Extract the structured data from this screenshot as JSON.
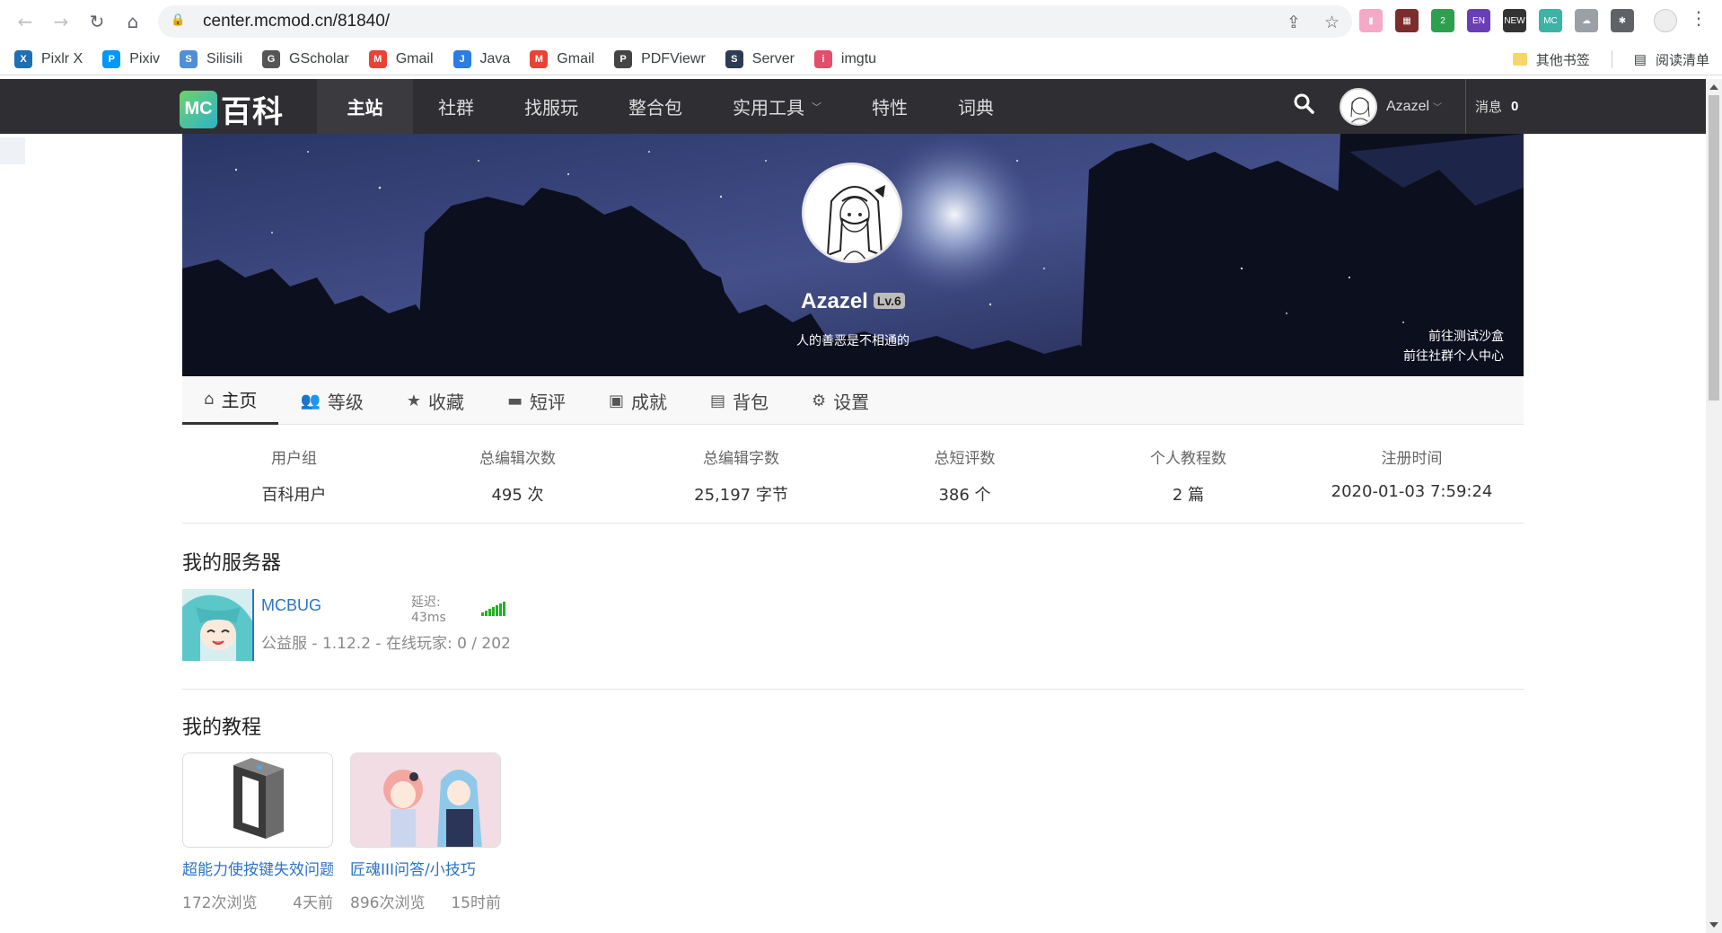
{
  "browser": {
    "url": "center.mcmod.cn/81840/",
    "bookmarks": [
      {
        "label": "Pixlr X",
        "color": "#1f6fb5",
        "glyph": "X"
      },
      {
        "label": "Pixiv",
        "color": "#0096fa",
        "glyph": "P"
      },
      {
        "label": "Silisili",
        "color": "#4f8fd8",
        "glyph": "S"
      },
      {
        "label": "GScholar",
        "color": "#555555",
        "glyph": "G"
      },
      {
        "label": "Gmail",
        "color": "#ea4335",
        "glyph": "M"
      },
      {
        "label": "Java",
        "color": "#2a7de1",
        "glyph": "J"
      },
      {
        "label": "Gmail",
        "color": "#ea4335",
        "glyph": "M"
      },
      {
        "label": "PDFViewr",
        "color": "#444444",
        "glyph": "P"
      },
      {
        "label": "Server",
        "color": "#2d3b55",
        "glyph": "S"
      },
      {
        "label": "imgtu",
        "color": "#e44d6b",
        "glyph": "i"
      }
    ],
    "other_bookmarks": "其他书签",
    "reading_list": "阅读清单",
    "extensions": [
      {
        "name": "bookmark-ext-icon",
        "color": "#f6a9c6",
        "glyph": "▮"
      },
      {
        "name": "grid-ext-icon",
        "color": "#7b2d2d",
        "glyph": "▦"
      },
      {
        "name": "shield-ext-icon",
        "color": "#2e9e4f",
        "glyph": "2"
      },
      {
        "name": "translate-ext-icon",
        "color": "#6a3fb6",
        "glyph": "EN"
      },
      {
        "name": "news-ext-icon",
        "color": "#333333",
        "glyph": "NEW"
      },
      {
        "name": "mcmod-ext-icon",
        "color": "#3cb3a4",
        "glyph": "MC"
      },
      {
        "name": "cloud-ext-icon",
        "color": "#9aa0a6",
        "glyph": "☁"
      },
      {
        "name": "puzzle-ext-icon",
        "color": "#5f6368",
        "glyph": "✱"
      }
    ]
  },
  "site": {
    "logo_mc": "MC",
    "logo_text": "百科",
    "nav": [
      {
        "label": "主站",
        "active": true
      },
      {
        "label": "社群"
      },
      {
        "label": "找服玩"
      },
      {
        "label": "整合包"
      },
      {
        "label": "实用工具",
        "dropdown": true
      },
      {
        "label": "特性"
      },
      {
        "label": "词典"
      }
    ],
    "username": "Azazel",
    "messages_label": "消息",
    "messages_count": "0"
  },
  "profile": {
    "name": "Azazel",
    "level": "Lv.6",
    "motto": "人的善恶是不相通的",
    "link_sandbox": "前往测试沙盒",
    "link_community": "前往社群个人中心"
  },
  "tabs": [
    {
      "label": "主页",
      "icon": "home-icon",
      "glyph": "⌂"
    },
    {
      "label": "等级",
      "icon": "users-icon",
      "glyph": "👥"
    },
    {
      "label": "收藏",
      "icon": "star-icon",
      "glyph": "★"
    },
    {
      "label": "短评",
      "icon": "comment-icon",
      "glyph": "▬"
    },
    {
      "label": "成就",
      "icon": "calendar-check-icon",
      "glyph": "▣"
    },
    {
      "label": "背包",
      "icon": "briefcase-icon",
      "glyph": "▤"
    },
    {
      "label": "设置",
      "icon": "gear-icon",
      "glyph": "⚙"
    }
  ],
  "stats": [
    {
      "label": "用户组",
      "value": "百科用户"
    },
    {
      "label": "总编辑次数",
      "value": "495 次"
    },
    {
      "label": "总编辑字数",
      "value": "25,197 字节"
    },
    {
      "label": "总短评数",
      "value": "386 个"
    },
    {
      "label": "个人教程数",
      "value": "2 篇"
    },
    {
      "label": "注册时间",
      "value": "2020-01-03 7:59:24"
    }
  ],
  "servers_title": "我的服务器",
  "server": {
    "name": "MCBUG",
    "ping": "延迟: 43ms",
    "info": "公益服 - 1.12.2 - 在线玩家: 0 / 202"
  },
  "tutorials_title": "我的教程",
  "tutorials": [
    {
      "title": "超能力使按键失效问题",
      "views": "172次浏览",
      "time": "4天前"
    },
    {
      "title": "匠魂III问答/小技巧",
      "views": "896次浏览",
      "time": "15时前"
    }
  ]
}
